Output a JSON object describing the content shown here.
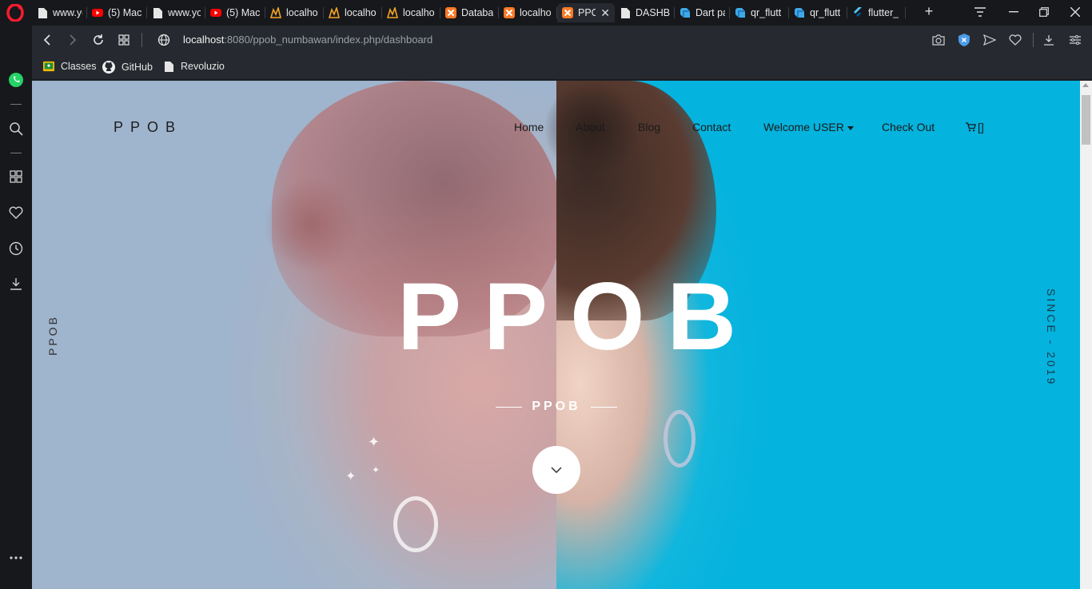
{
  "browser": {
    "tabs": [
      {
        "label": "www.yo",
        "icon": "page-icon"
      },
      {
        "label": "(5) Mac",
        "icon": "youtube-icon"
      },
      {
        "label": "www.yo",
        "icon": "page-icon"
      },
      {
        "label": "(5) Mac",
        "icon": "youtube-icon"
      },
      {
        "label": "localho",
        "icon": "codeigniter-icon"
      },
      {
        "label": "localho",
        "icon": "codeigniter-icon"
      },
      {
        "label": "localho",
        "icon": "codeigniter-icon"
      },
      {
        "label": "Databa",
        "icon": "xampp-icon"
      },
      {
        "label": "localho",
        "icon": "xampp-icon"
      },
      {
        "label": "PPO",
        "icon": "xampp-icon"
      },
      {
        "label": "DASHB",
        "icon": "page-icon"
      },
      {
        "label": "Dart pa",
        "icon": "dart-icon"
      },
      {
        "label": "qr_flutt",
        "icon": "dart-icon"
      },
      {
        "label": "qr_flutt",
        "icon": "dart-icon"
      },
      {
        "label": "flutter_",
        "icon": "flutter-icon"
      }
    ],
    "active_tab_index": 9,
    "address": {
      "host": "localhost",
      "rest": ":8080/ppob_numbawan/index.php/dashboard"
    },
    "bookmarks": [
      {
        "label": "Classes",
        "icon": "classroom-icon"
      },
      {
        "label": "GitHub",
        "icon": "github-icon"
      },
      {
        "label": "Revoluzio",
        "icon": "page-icon"
      }
    ],
    "colors": {
      "opera_red": "#ff1b2d",
      "whatsapp_green": "#25d366",
      "accent_blue": "#1a73e8"
    }
  },
  "site": {
    "brand": "PPOB",
    "nav": {
      "home": "Home",
      "about": "About",
      "blog": "Blog",
      "contact": "Contact",
      "welcome": "Welcome USER",
      "checkout": "Check Out",
      "cart": "[]"
    },
    "hero": {
      "title": "PPOB",
      "subtitle": "PPOB",
      "side_left": "PPOB",
      "side_right": "SINCE - 2019"
    }
  }
}
